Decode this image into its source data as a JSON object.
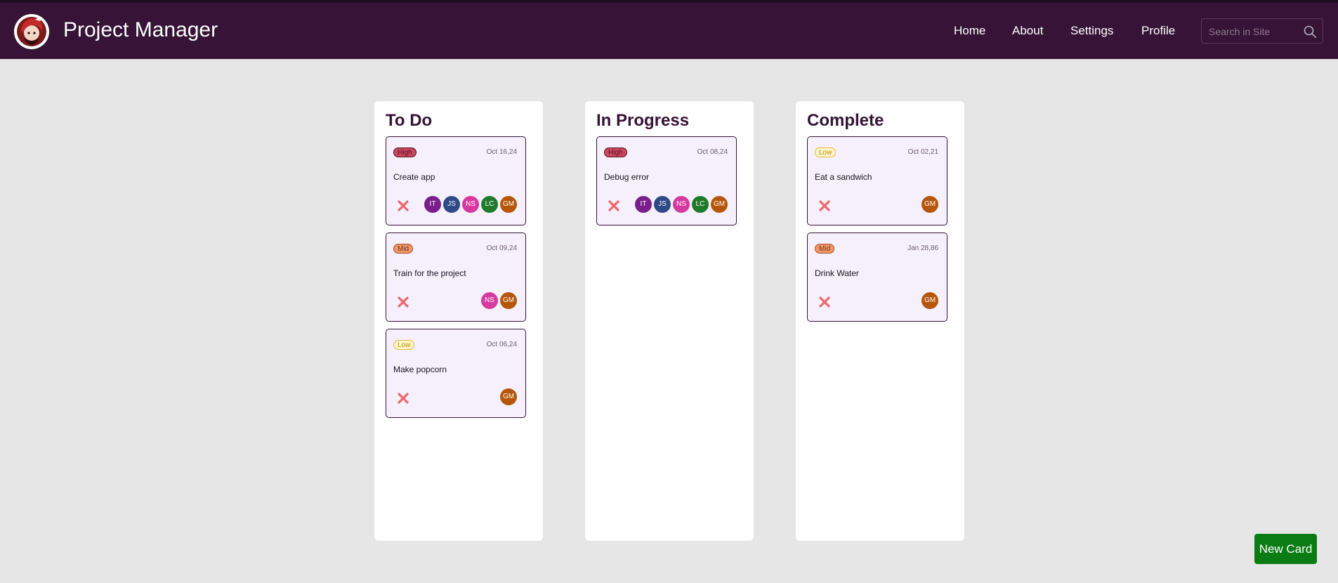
{
  "header": {
    "app_title": "Project Manager",
    "nav": [
      {
        "label": "Home"
      },
      {
        "label": "About"
      },
      {
        "label": "Settings"
      },
      {
        "label": "Profile"
      }
    ],
    "search": {
      "placeholder": "Search in Site",
      "value": ""
    },
    "background": "#361337"
  },
  "board": {
    "columns": [
      {
        "title": "To Do",
        "cards": [
          {
            "priority": "High",
            "date": "Oct 16,24",
            "title": "Create app",
            "assignees": [
              "IT",
              "JS",
              "NS",
              "LC",
              "GM"
            ]
          },
          {
            "priority": "Mid",
            "date": "Oct 09,24",
            "title": "Train for the project",
            "assignees": [
              "NS",
              "GM"
            ]
          },
          {
            "priority": "Low",
            "date": "Oct 06,24",
            "title": "Make popcorn",
            "assignees": [
              "GM"
            ]
          }
        ]
      },
      {
        "title": "In Progress",
        "cards": [
          {
            "priority": "High",
            "date": "Oct 08,24",
            "title": "Debug error",
            "assignees": [
              "IT",
              "JS",
              "NS",
              "LC",
              "GM"
            ]
          }
        ]
      },
      {
        "title": "Complete",
        "cards": [
          {
            "priority": "Low",
            "date": "Oct 02,21",
            "title": "Eat a sandwich",
            "assignees": [
              "GM"
            ]
          },
          {
            "priority": "Mid",
            "date": "Jan 28,86",
            "title": "Drink Water",
            "assignees": [
              "GM"
            ]
          }
        ]
      }
    ]
  },
  "avatar_colors": {
    "IT": "#7b1e8c",
    "JS": "#2e4a86",
    "NS": "#d63aa0",
    "LC": "#1f7a2a",
    "GM": "#b5560a"
  },
  "new_card_label": "New Card",
  "icons": {
    "delete": "close-x-icon",
    "search": "search-icon",
    "logo": "avatar-logo"
  }
}
